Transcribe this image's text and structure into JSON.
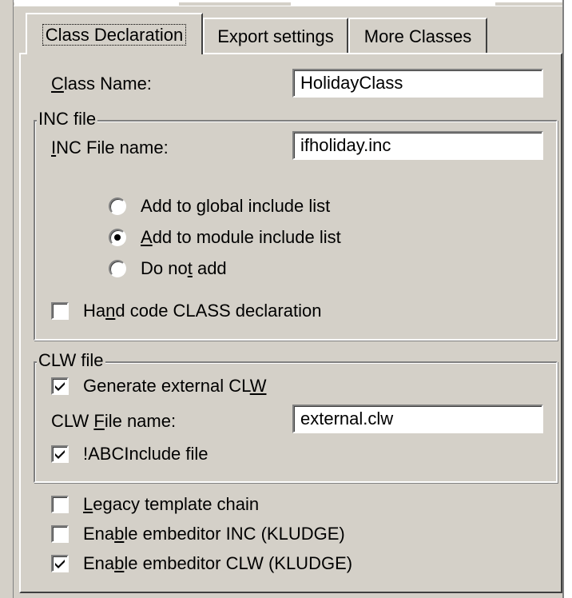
{
  "tabs": [
    {
      "label": "Class Declaration",
      "active": true
    },
    {
      "label": "Export settings",
      "active": false
    },
    {
      "label": "More Classes",
      "active": false
    }
  ],
  "class_name": {
    "prefix": "",
    "mnemonic": "C",
    "rest": "lass Name:",
    "value": "HolidayClass"
  },
  "inc_group": {
    "title": "INC file",
    "file_name": {
      "prefix": "",
      "mnemonic": "I",
      "rest": "NC File name:",
      "value": "ifholiday.inc"
    },
    "radios": [
      {
        "prefix": "Add to ",
        "mnemonic": "g",
        "rest": "lobal include list",
        "selected": false
      },
      {
        "prefix": "",
        "mnemonic": "A",
        "rest": "dd to module include list",
        "selected": true
      },
      {
        "prefix": "Do no",
        "mnemonic": "t",
        "rest": " add",
        "selected": false
      }
    ],
    "hand_code": {
      "prefix": "Ha",
      "mnemonic": "n",
      "rest": "d code CLASS declaration",
      "checked": false
    }
  },
  "clw_group": {
    "title": "CLW file",
    "generate": {
      "prefix": "Generate external CL",
      "mnemonic": "W",
      "rest": "",
      "checked": true
    },
    "file_name": {
      "prefix": "CLW ",
      "mnemonic": "F",
      "rest": "ile name:",
      "value": "external.clw"
    },
    "abc_include": {
      "prefix": "!ABCInclude file",
      "mnemonic": "",
      "rest": "",
      "checked": true
    }
  },
  "options": [
    {
      "prefix": "",
      "mnemonic": "L",
      "rest": "egacy template chain",
      "checked": false
    },
    {
      "prefix": "Ena",
      "mnemonic": "b",
      "rest": "le embeditor INC (KLUDGE)",
      "checked": false
    },
    {
      "prefix": "Ena",
      "mnemonic": "b",
      "rest": "le embeditor CLW (KLUDGE)",
      "checked": true
    }
  ]
}
